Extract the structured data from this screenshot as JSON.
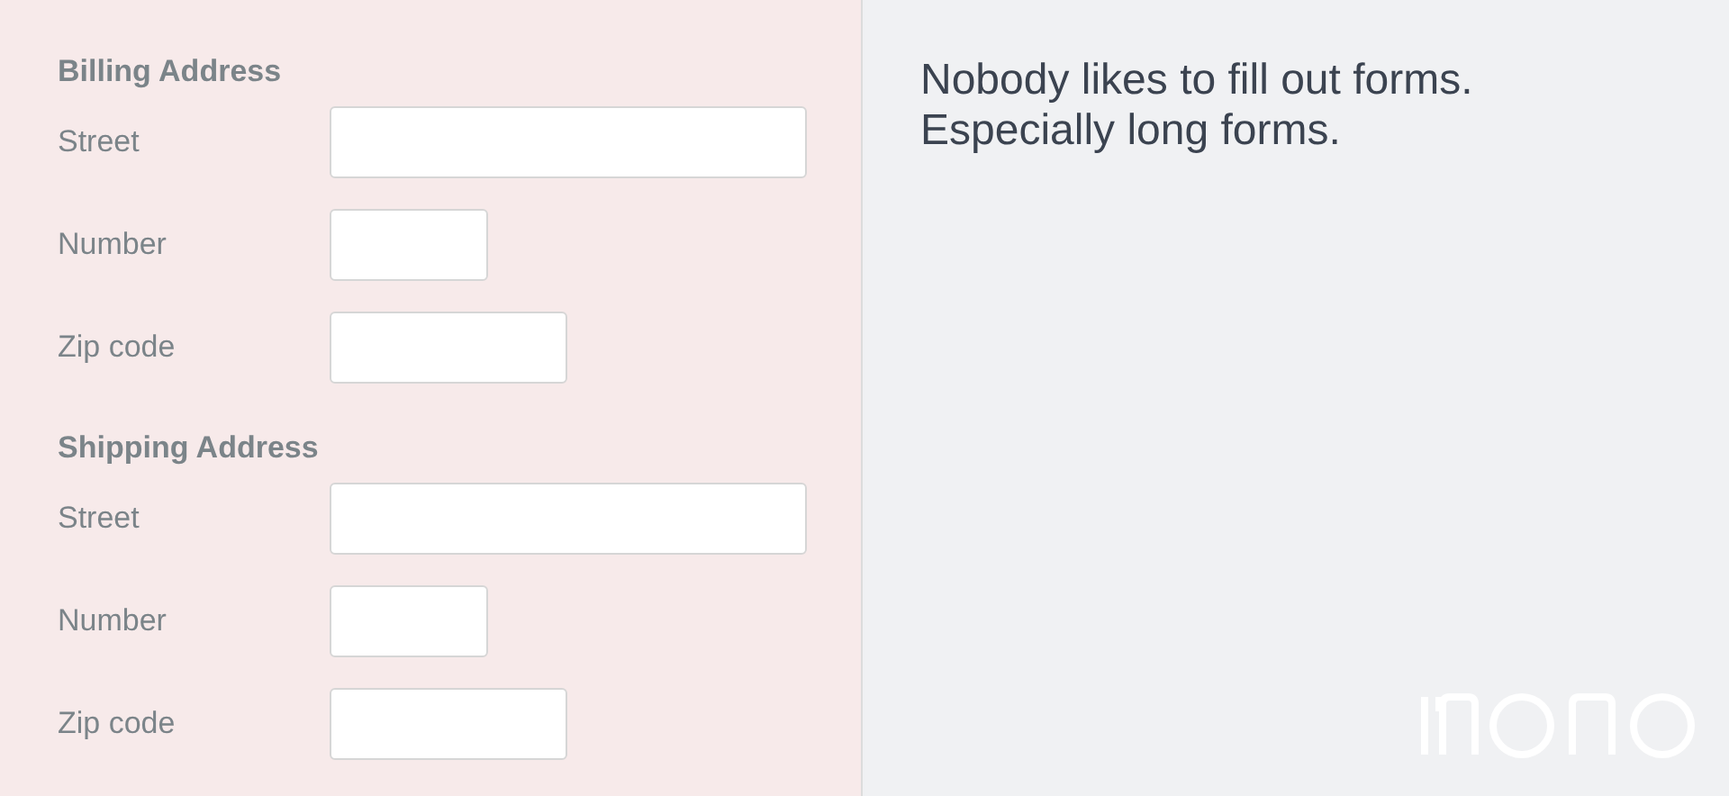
{
  "sections": [
    {
      "title": "Billing Address",
      "fields": [
        {
          "label": "Street",
          "kind": "long"
        },
        {
          "label": "Number",
          "kind": "short"
        },
        {
          "label": "Zip code",
          "kind": "medium"
        }
      ]
    },
    {
      "title": "Shipping Address",
      "fields": [
        {
          "label": "Street",
          "kind": "long"
        },
        {
          "label": "Number",
          "kind": "short"
        },
        {
          "label": "Zip code",
          "kind": "medium"
        }
      ]
    }
  ],
  "message": [
    "Nobody likes to fill out forms.",
    "Especially long forms."
  ]
}
